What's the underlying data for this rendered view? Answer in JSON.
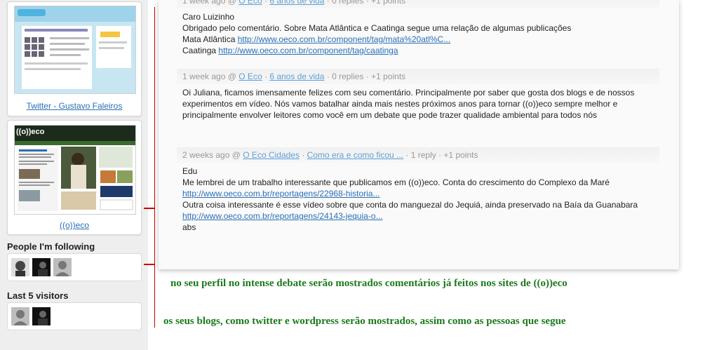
{
  "sidebar": {
    "site1": {
      "label": "Twitter - Gustavo Faleiros",
      "thumb_logo": "twitter"
    },
    "site2": {
      "label": "((o))eco",
      "thumb_logo": "((o))eco"
    },
    "following_heading": "People I'm following",
    "visitors_heading": "Last 5 visitors"
  },
  "comments": [
    {
      "meta": {
        "time": "1 week ago",
        "at": "@",
        "author": "O Eco",
        "sep1": "·",
        "post": "6 anos de vida",
        "sep2": "·",
        "replies": "0 replies",
        "sep3": "·",
        "points": "+1 points"
      },
      "lines": {
        "l1": "Caro Luizinho",
        "l2": "Obrigado pelo comentário. Sobre Mata Atlântica e Caatinga segue uma relação de algumas publicações",
        "l3_text": "Mata Atlântica",
        "l3_link": "http://www.oeco.com.br/component/tag/mata%20atl%C...",
        "l4_text": "Caatinga",
        "l4_link": "http://www.oeco.com.br/component/tag/caatinga"
      }
    },
    {
      "meta": {
        "time": "1 week ago",
        "at": "@",
        "author": "O Eco",
        "sep1": "·",
        "post": "6 anos de vida",
        "sep2": "·",
        "replies": "0 replies",
        "sep3": "·",
        "points": "+1 points"
      },
      "lines": {
        "l1": "Oi Juliana, ficamos imensamente felizes com seu comentário. Principalmente por saber que gosta dos blogs e de nossos experimentos em vídeo. Nós vamos batalhar ainda mais nestes próximos anos para tornar ((o))eco sempre melhor e principalmente envolver leitores como você em um debate que pode trazer qualidade ambiental para todos nós"
      }
    },
    {
      "meta": {
        "time": "2 weeks ago",
        "at": "@",
        "author": "O Eco Cidades",
        "sep1": "·",
        "post": "Como era e como ficou ...",
        "sep2": "·",
        "replies": "1 reply",
        "sep3": "·",
        "points": "+1 points"
      },
      "lines": {
        "l1": "Edu",
        "l2": "Me lembrei de um trabalho interessante que publicamos em ((o))eco. Conta do crescimento do Complexo da Maré",
        "l3_link": "http://www.oeco.com.br/reportagens/22968-historia...",
        "l4": "Outra coisa interessante é esse vídeo sobre que conta do manguezal do Jequiá, ainda preservado na Baía da Guanabara",
        "l4_link": "http://www.oeco.com.br/reportagens/24143-jequia-o...",
        "l5": "abs"
      }
    }
  ],
  "notes": {
    "n1": "no seu perfil no intense debate serão mostrados comentários já feitos nos sites de ((o))eco",
    "n2": "os seus blogs, como twitter e wordpress serão mostrados, assim como as pessoas que segue"
  },
  "colors": {
    "annotation_red": "#cc0000",
    "annotation_green": "#1a7a1a",
    "link": "#2a6fb5",
    "meta": "#999999"
  }
}
